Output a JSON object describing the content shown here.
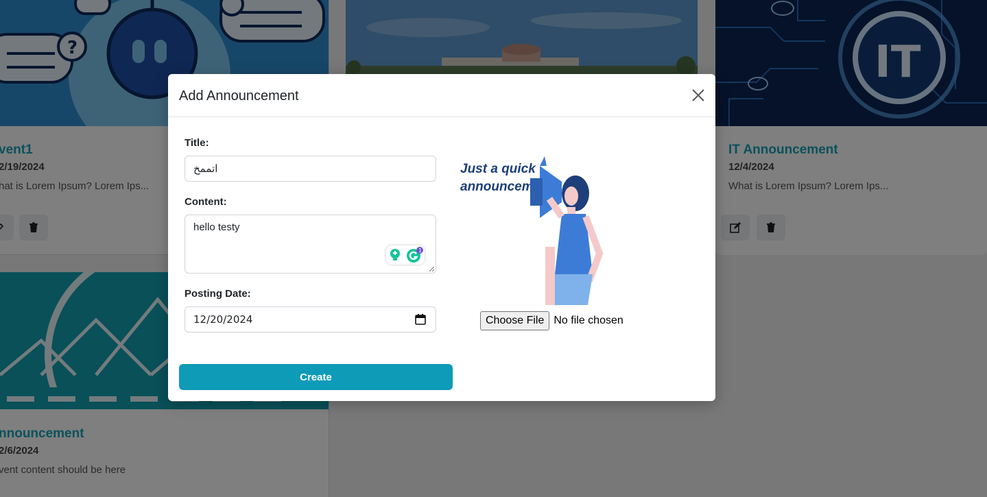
{
  "cards": [
    {
      "title": "vent1",
      "date": "2/19/2024",
      "desc": "hat is Lorem Ipsum? Lorem Ips..."
    },
    {
      "title": "IT Announcement",
      "date": "12/4/2024",
      "desc": "What is Lorem Ipsum? Lorem Ips..."
    },
    {
      "title": "nnouncement",
      "date": "2/6/2024",
      "desc": "vent content should be here"
    }
  ],
  "card_art": {
    "it_logo": "IT"
  },
  "modal": {
    "title": "Add Announcement",
    "fields": {
      "title_label": "Title:",
      "title_value": "اتممخ",
      "content_label": "Content:",
      "content_value": "hello testy",
      "date_label": "Posting Date:",
      "date_value": "12/20/2024"
    },
    "grammarly_badge": "1",
    "image": {
      "text_line1": "Just a quick",
      "text_line2": "announcement:"
    },
    "file": {
      "button_label": "Choose File",
      "status": "No file chosen"
    },
    "create_label": "Create"
  },
  "colors": {
    "accent": "#0d9bb7",
    "card_title": "#17a2b8"
  }
}
